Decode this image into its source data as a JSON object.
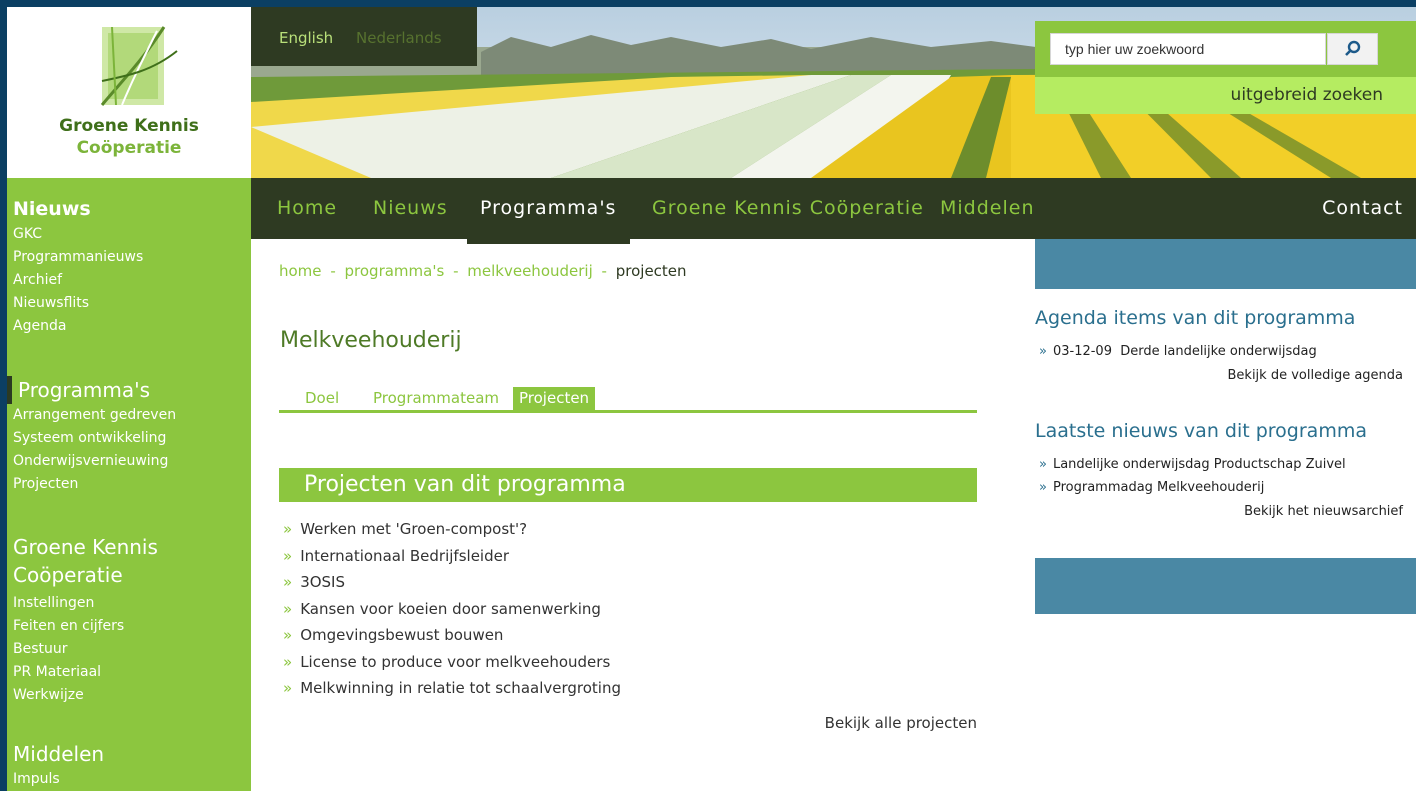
{
  "colors": {
    "brand_green": "#8cc63f",
    "dark_olive": "#2e3a22",
    "teal": "#4a88a4",
    "frame_blue": "#0b3f63"
  },
  "logo": {
    "line1": "Groene Kennis",
    "line2": "Coöperatie"
  },
  "languages": [
    "English",
    "Nederlands"
  ],
  "search": {
    "placeholder": "typ hier uw zoekwoord",
    "button_icon": "search-icon",
    "advanced_label": "uitgebreid zoeken"
  },
  "nav": {
    "items": [
      "Home",
      "Nieuws",
      "Programma's",
      "Groene Kennis Coöperatie",
      "Middelen"
    ],
    "active": "Programma's",
    "contact": "Contact"
  },
  "sidebar": {
    "sections": [
      {
        "title": "Nieuws",
        "links": [
          "GKC",
          "Programmanieuws",
          "Archief",
          "Nieuwsflits",
          "Agenda"
        ]
      },
      {
        "title": "Programma's",
        "links": [
          "Arrangement gedreven",
          "Systeem ontwikkeling",
          "Onderwijsvernieuwing",
          "Projecten"
        ]
      },
      {
        "title_line1": "Groene Kennis",
        "title_line2": "Coöperatie",
        "links": [
          "Instellingen",
          "Feiten en cijfers",
          "Bestuur",
          "PR Materiaal",
          "Werkwijze"
        ]
      },
      {
        "title": "Middelen",
        "links": [
          "Impuls"
        ]
      }
    ]
  },
  "breadcrumb": {
    "items": [
      "home",
      "programma's",
      "melkveehouderij"
    ],
    "current": "projecten",
    "separator": "-"
  },
  "page": {
    "title": "Melkveehouderij",
    "tabs": [
      "Doel",
      "Programmateam",
      "Projecten"
    ],
    "active_tab": "Projecten",
    "projects_heading": "Projecten van dit programma",
    "projects": [
      "Werken met 'Groen-compost'?",
      "Internationaal Bedrijfsleider",
      "3OSIS",
      "Kansen voor koeien door samenwerking",
      "Omgevingsbewust bouwen",
      "License to produce voor melkveehouders",
      "Melkwinning in relatie tot schaalvergroting"
    ],
    "all_projects_link": "Bekijk alle projecten"
  },
  "right": {
    "agenda_title": "Agenda items van dit programma",
    "agenda_items": [
      {
        "date": "03-12-09",
        "text": "Derde landelijke onderwijsdag"
      }
    ],
    "agenda_link": "Bekijk de volledige agenda",
    "news_title": "Laatste nieuws van dit programma",
    "news_items": [
      "Landelijke onderwijsdag Productschap Zuivel",
      "Programmadag Melkveehouderij"
    ],
    "news_link": "Bekijk het nieuwsarchief"
  },
  "bullet": "»"
}
